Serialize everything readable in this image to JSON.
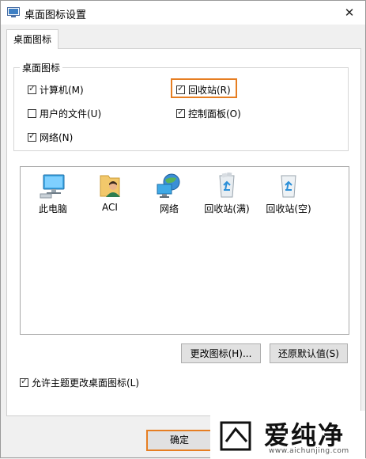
{
  "window": {
    "title": "桌面图标设置",
    "close_glyph": "✕"
  },
  "tabs": [
    {
      "label": "桌面图标",
      "active": true
    }
  ],
  "group": {
    "title": "桌面图标",
    "checkboxes": [
      {
        "label": "计算机(M)",
        "checked": true
      },
      {
        "label": "回收站(R)",
        "checked": true,
        "highlighted": true
      },
      {
        "label": "用户的文件(U)",
        "checked": false
      },
      {
        "label": "控制面板(O)",
        "checked": true
      },
      {
        "label": "网络(N)",
        "checked": true
      }
    ]
  },
  "icons": [
    {
      "label": "此电脑",
      "icon": "computer-icon"
    },
    {
      "label": "ACI",
      "icon": "user-folder-icon"
    },
    {
      "label": "网络",
      "icon": "network-icon"
    },
    {
      "label": "回收站(满)",
      "icon": "recycle-bin-full-icon"
    },
    {
      "label": "回收站(空)",
      "icon": "recycle-bin-empty-icon"
    }
  ],
  "buttons": {
    "change_icon": "更改图标(H)...",
    "restore_default": "还原默认值(S)",
    "ok": "确定"
  },
  "allow_theme": {
    "label": "允许主题更改桌面图标(L)",
    "checked": true
  },
  "watermark": {
    "name": "爱纯净",
    "url": "www.aichunjing.com"
  },
  "colors": {
    "highlight": "#e67e22",
    "tick": "✓"
  }
}
